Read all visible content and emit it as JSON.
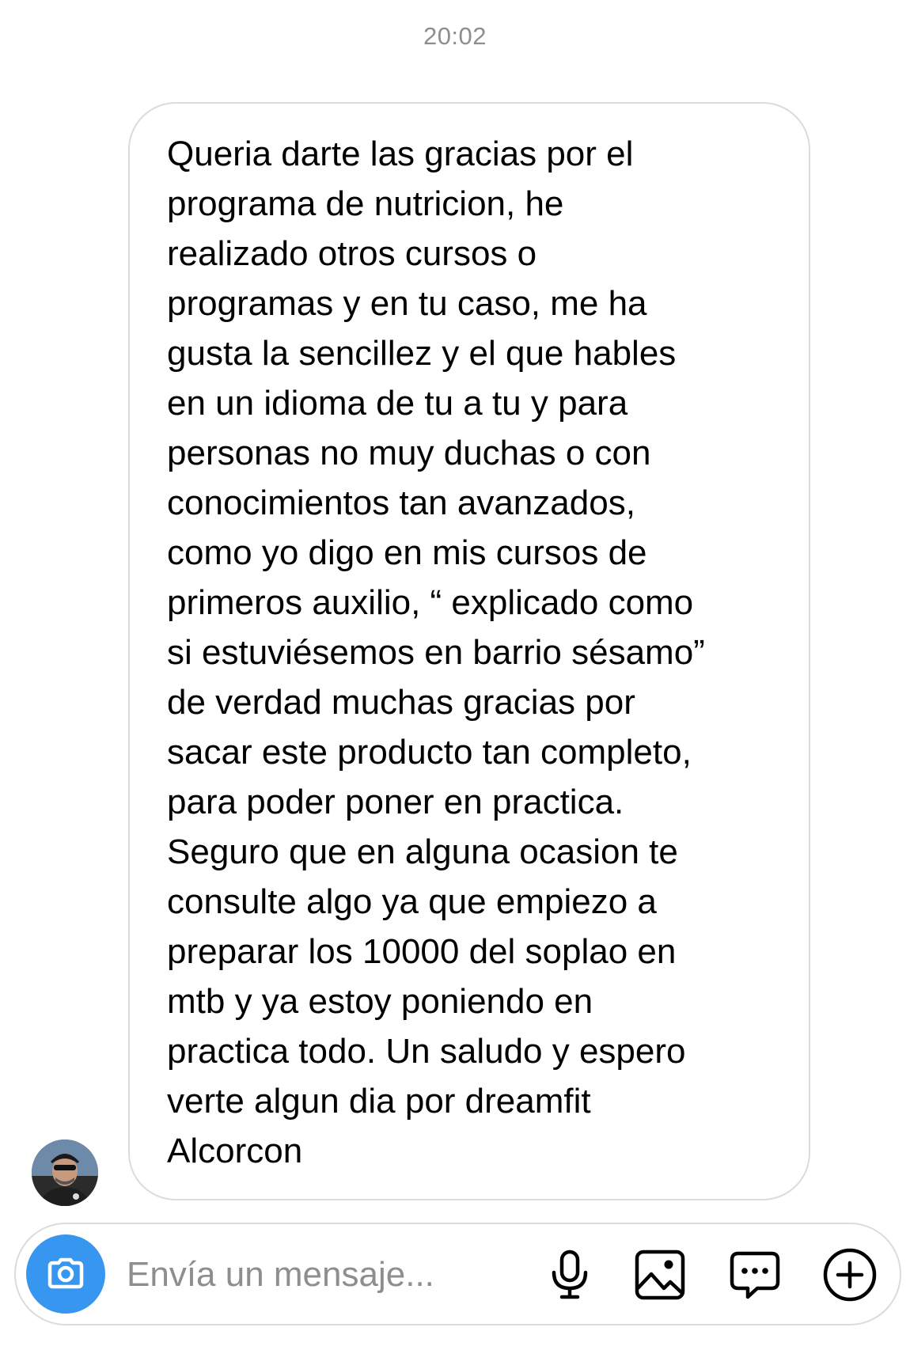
{
  "thread": {
    "timestamp": "20:02"
  },
  "message": {
    "sender_avatar": "profile-photo-cyclist",
    "text": "Queria darte las gracias por el\nprograma de nutricion, he\nrealizado otros cursos o\nprogramas y en tu caso, me ha\ngusta la sencillez y el que hables\nen un idioma de tu a tu y para\npersonas no muy duchas o con\nconocimientos tan avanzados,\ncomo yo digo en mis cursos de\nprimeros auxilio, “ explicado como\nsi estuviésemos en barrio sésamo”\nde verdad muchas gracias por\nsacar este producto tan completo,\npara poder poner en practica.\nSeguro que en alguna ocasion te\nconsulte algo ya que empiezo a\npreparar los 10000 del soplao en\nmtb y ya estoy poniendo en\npractica todo. Un saludo y espero\nverte algun dia por dreamfit\nAlcorcon"
  },
  "composer": {
    "placeholder": "Envía un mensaje...",
    "value": "",
    "icons": [
      "camera-icon",
      "microphone-icon",
      "image-icon",
      "sticker-icon",
      "plus-icon"
    ],
    "camera_button_color": "#3797f0"
  }
}
